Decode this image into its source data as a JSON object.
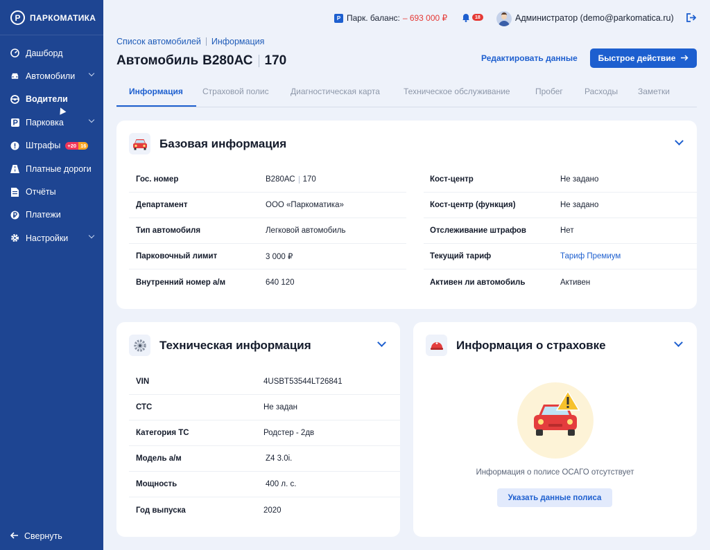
{
  "sidebar": {
    "logo_letter": "P",
    "logo_text": "ПАРКОМАТИКА",
    "items": [
      {
        "label": "Дашборд",
        "icon": "dashboard-icon"
      },
      {
        "label": "Автомобили",
        "icon": "car-icon"
      },
      {
        "label": "Водители",
        "icon": "steering-wheel-icon"
      },
      {
        "label": "Парковка",
        "icon": "parking-icon"
      },
      {
        "label": "Штрафы",
        "icon": "alert-icon"
      },
      {
        "label": "Платные дороги",
        "icon": "road-icon"
      },
      {
        "label": "Отчёты",
        "icon": "reports-icon"
      },
      {
        "label": "Платежи",
        "icon": "ruble-icon"
      },
      {
        "label": "Настройки",
        "icon": "gear-icon"
      }
    ],
    "fines_badges": [
      "+20",
      "16"
    ],
    "collapse_label": "Свернуть"
  },
  "topbar": {
    "balance_label": "Парк. баланс:",
    "balance_value": "– 693 000 ₽",
    "notif_count": "18",
    "user": "Администратор (demo@parkomatica.ru)"
  },
  "breadcrumbs": [
    "Список автомобилей",
    "Информация"
  ],
  "title": {
    "prefix": "Автомобиль",
    "plate": "В280АС",
    "region": "170"
  },
  "actions": {
    "edit": "Редактировать данные",
    "quick": "Быстрое действие"
  },
  "tabs": [
    "Информация",
    "Страховой полис",
    "Диагностическая карта",
    "Техническое обслуживание",
    "Пробег",
    "Расходы",
    "Заметки"
  ],
  "basic": {
    "title": "Базовая информация",
    "plate_label": "Гос. номер",
    "plate_main": "В280АС",
    "plate_region": "170",
    "left": [
      {
        "label": "Департамент",
        "value": "ООО «Паркоматика»"
      },
      {
        "label": "Тип автомобиля",
        "value": "Легковой автомобиль"
      },
      {
        "label": "Парковочный лимит",
        "value": "3 000 ₽"
      },
      {
        "label": "Внутренний номер а/м",
        "value": "640 120"
      }
    ],
    "right": [
      {
        "label": "Кост-центр",
        "value": "Не задано"
      },
      {
        "label": "Кост-центр (функция)",
        "value": "Не задано"
      },
      {
        "label": "Отслеживание штрафов",
        "value": "Нет"
      },
      {
        "label": "Текущий тариф",
        "value": "Тариф Премиум"
      },
      {
        "label": "Активен ли автомобиль",
        "value": "Активен"
      }
    ]
  },
  "tech": {
    "title": "Техническая информация",
    "rows": [
      {
        "label": "VIN",
        "value": "4USBT53544LT26841"
      },
      {
        "label": "СТС",
        "value": "Не задан"
      },
      {
        "label": "Категория ТС",
        "value": "Родстер - 2дв"
      },
      {
        "label": "Модель а/м",
        "value": "Z4 3.0i."
      },
      {
        "label": "Мощность",
        "value": "400 л. с."
      },
      {
        "label": "Год выпуска",
        "value": "2020"
      }
    ]
  },
  "insurance": {
    "title": "Информация о страховке",
    "empty_text": "Информация о полисе ОСАГО отсутствует",
    "button": "Указать данные полиса"
  },
  "colors": {
    "sidebar": "#1e4592",
    "accent": "#1d5fcf",
    "danger": "#e53935",
    "background": "#eef2fa"
  }
}
